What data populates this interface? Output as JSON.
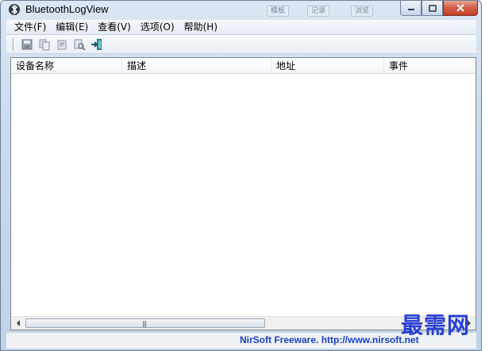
{
  "window": {
    "title": "BluetoothLogView",
    "background_peek": [
      "模板",
      "记录",
      "浏览"
    ]
  },
  "menu": {
    "items": [
      "文件(F)",
      "编辑(E)",
      "查看(V)",
      "选项(O)",
      "帮助(H)"
    ]
  },
  "toolbar": {
    "buttons": [
      "save-icon",
      "copy-icon",
      "properties-icon",
      "find-icon",
      "exit-icon"
    ]
  },
  "list": {
    "columns": [
      "设备名称",
      "描述",
      "地址",
      "事件"
    ],
    "rows": []
  },
  "statusbar": {
    "link_text": "NirSoft Freeware.  http://www.nirsoft.net"
  },
  "watermark": "最需网",
  "colors": {
    "status_link": "#1a3fc4",
    "watermark": "#2a3fd3",
    "close_button": "#c23f24"
  }
}
